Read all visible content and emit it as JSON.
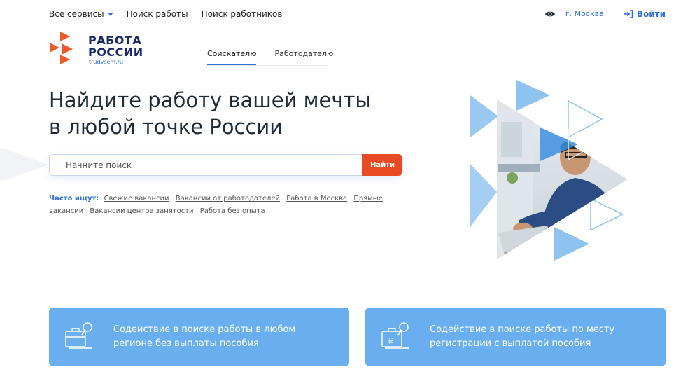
{
  "topnav": {
    "services_label": "Все сервисы",
    "job_search_label": "Поиск работы",
    "worker_search_label": "Поиск работников"
  },
  "topright": {
    "accessibility_icon": "eye-icon",
    "city_label": "г. Москва",
    "login_label": "Войти"
  },
  "logo": {
    "line1": "РАБОТА",
    "line2": "РОССИИ",
    "subtitle": "trudvsem.ru"
  },
  "tabs": [
    {
      "label": "Соискателю",
      "active": true
    },
    {
      "label": "Работодателю",
      "active": false
    }
  ],
  "hero": {
    "title_line1": "Найдите работу вашей мечты",
    "title_line2": "в любой точке России"
  },
  "search": {
    "placeholder": "Начните поиск",
    "button_label": "Найти"
  },
  "often": {
    "label": "Часто ищут:",
    "links": [
      "Свежие вакансии",
      "Вакансии от работодателей",
      "Работа в Москве",
      "Прямые вакансии",
      "Вакансии центра занятости",
      "Работа без опыта"
    ]
  },
  "cards": [
    {
      "icon": "briefcase-search-icon",
      "text": "Содействие в поиске работы в любом регионе без выплаты пособия"
    },
    {
      "icon": "briefcase-ruble-search-icon",
      "text": "Содействие в поиске работы по месту регистрации с выплатой пособия"
    }
  ],
  "colors": {
    "accent_blue": "#2d6fd6",
    "search_button": "#e84b24",
    "card_bg": "#69aff0",
    "logo_orange": "#f05a28",
    "logo_navy": "#17296b"
  }
}
